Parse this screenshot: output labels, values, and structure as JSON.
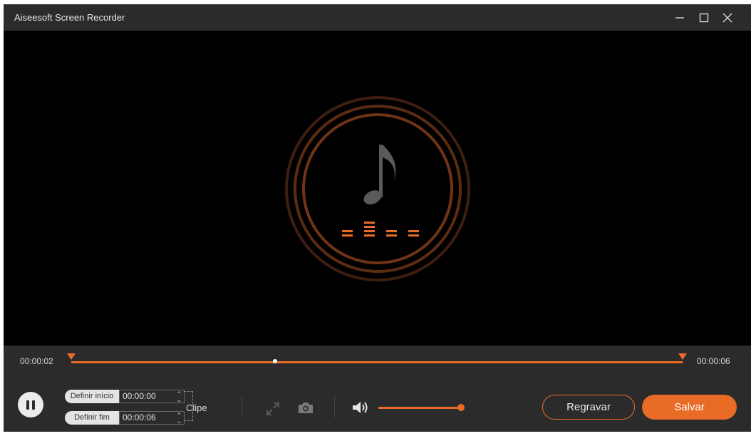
{
  "window": {
    "title": "Aiseesoft Screen Recorder",
    "buttons": [
      "minimize-icon",
      "maximize-icon",
      "close-icon"
    ]
  },
  "stage": {
    "artwork": "music-note-icon",
    "accent_color": "#e86b26"
  },
  "timeline": {
    "start_time": "00:00:02",
    "end_time": "00:00:06",
    "playhead_fraction": 0.33
  },
  "controls": {
    "set_start_label": "Definir início",
    "set_start_value": "00:00:00",
    "set_end_label": "Definir fim",
    "set_end_value": "00:00:06",
    "clip_label": "Clipe",
    "volume_fraction": 1.0,
    "regravar_label": "Regravar",
    "salvar_label": "Salvar"
  },
  "colors": {
    "accent": "#e86b26",
    "panel": "#2b2b2b",
    "stage": "#000000"
  }
}
